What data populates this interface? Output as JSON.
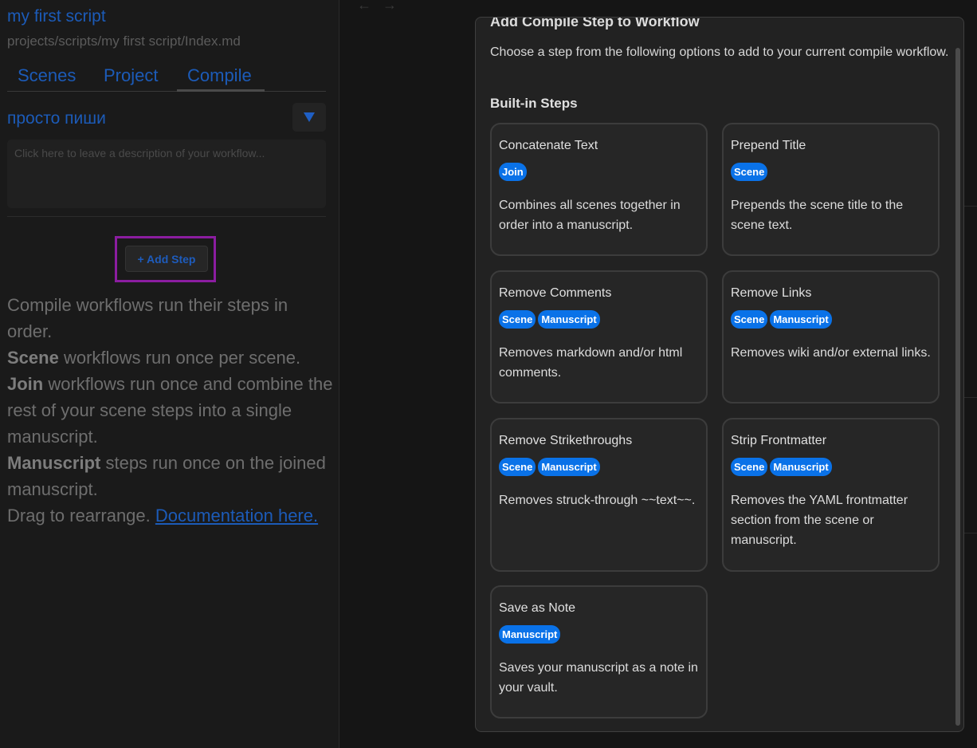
{
  "sidebar": {
    "script_title": "my first script",
    "script_path": "projects/scripts/my first script/Index.md",
    "tabs": [
      {
        "label": "Scenes"
      },
      {
        "label": "Project"
      },
      {
        "label": "Compile"
      }
    ],
    "active_tab": "Compile",
    "workflow_name": "просто пиши",
    "description_placeholder": "Click here to leave a description of your workflow...",
    "add_step_label": "+ Add Step",
    "help": {
      "line1": "Compile workflows run their steps in order.",
      "scene_bold": "Scene",
      "scene_rest": " workflows run once per scene.",
      "join_bold": "Join",
      "join_rest": " workflows run once and combine the rest of your scene steps into a single manuscript.",
      "manuscript_bold": "Manuscript",
      "manuscript_rest": " steps run once on the joined manuscript.",
      "drag_text": "Drag to rearrange. ",
      "doc_link": "Documentation here."
    }
  },
  "nav": {
    "back_icon": "←",
    "forward_icon": "→"
  },
  "modal": {
    "title": "Add Compile Step to Workflow",
    "intro": "Choose a step from the following options to add to your current compile workflow.",
    "section_title": "Built-in Steps",
    "steps": [
      {
        "title": "Concatenate Text",
        "tags": [
          "Join"
        ],
        "description": "Combines all scenes together in order into a manuscript."
      },
      {
        "title": "Prepend Title",
        "tags": [
          "Scene"
        ],
        "description": "Prepends the scene title to the scene text."
      },
      {
        "title": "Remove Comments",
        "tags": [
          "Scene",
          "Manuscript"
        ],
        "description": "Removes markdown and/or html comments."
      },
      {
        "title": "Remove Links",
        "tags": [
          "Scene",
          "Manuscript"
        ],
        "description": "Removes wiki and/or external links."
      },
      {
        "title": "Remove Strikethroughs",
        "tags": [
          "Scene",
          "Manuscript"
        ],
        "description": "Removes struck-through ~~text~~."
      },
      {
        "title": "Strip Frontmatter",
        "tags": [
          "Scene",
          "Manuscript"
        ],
        "description": "Removes the YAML frontmatter section from the scene or manuscript."
      },
      {
        "title": "Save as Note",
        "tags": [
          "Manuscript"
        ],
        "description": "Saves your manuscript as a note in your vault."
      }
    ]
  },
  "colors": {
    "accent": "#1c5bb8",
    "tag_bg": "#0a72e8",
    "highlight": "#8b1da0"
  }
}
